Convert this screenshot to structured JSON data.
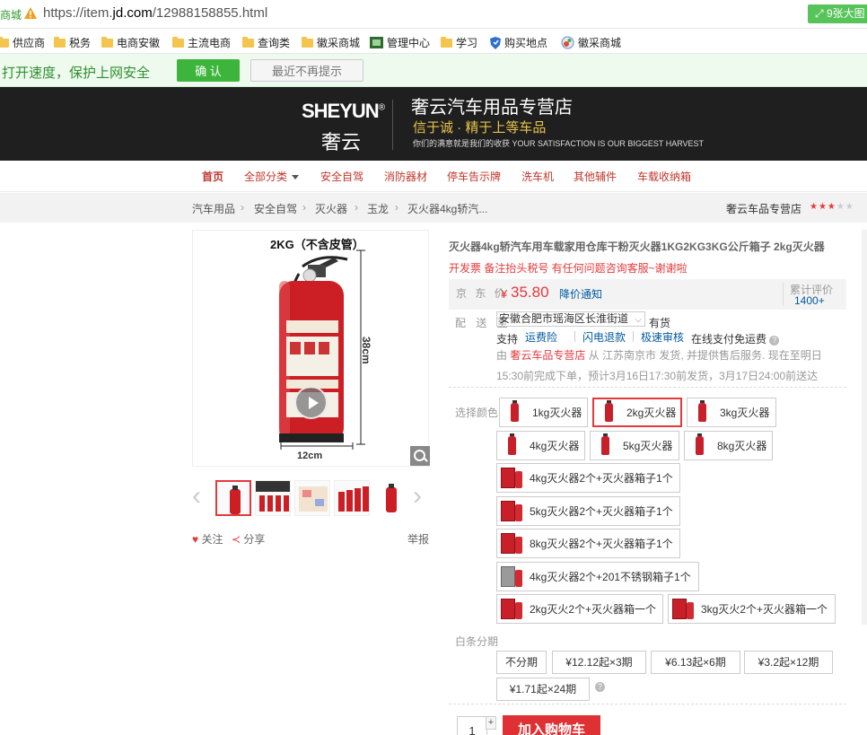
{
  "browser": {
    "url_prefix": "商城",
    "url_scheme": "https://item.",
    "url_domain": "jd.com",
    "url_path": "/12988158855.html",
    "pill_label": "9张大图"
  },
  "bookmarks": [
    {
      "label": "供应商",
      "icon": "folder-icon"
    },
    {
      "label": "税务",
      "icon": "folder-icon"
    },
    {
      "label": "电商安徽",
      "icon": "folder-icon"
    },
    {
      "label": "主流电商",
      "icon": "folder-icon"
    },
    {
      "label": "查询类",
      "icon": "folder-icon"
    },
    {
      "label": "徽采商城",
      "icon": "folder-icon"
    },
    {
      "label": "管理中心",
      "icon": "admin-icon"
    },
    {
      "label": "学习",
      "icon": "folder-icon"
    },
    {
      "label": "购买地点",
      "icon": "shield-icon"
    },
    {
      "label": "徽采商城",
      "icon": "globe-icon"
    }
  ],
  "notice": {
    "message": "打开速度，保护上网安全",
    "confirm_label": "确 认",
    "never_label": "最近不再提示"
  },
  "banner": {
    "logo_en": "SHEYUN",
    "logo_reg": "®",
    "logo_cn": "奢云",
    "shop_name": "奢云汽车用品专营店",
    "slogan": "信于诚 · 精于上等车品",
    "tagline": "你们的满意就是我们的收获 YOUR SATISFACTION IS OUR BIGGEST HARVEST"
  },
  "shop_nav": [
    "首页",
    "全部分类",
    "安全自驾",
    "消防器材",
    "停车告示牌",
    "洗车机",
    "其他辅件",
    "车载收纳箱"
  ],
  "breadcrumb": [
    "汽车用品",
    "安全自驾",
    "灭火器",
    "玉龙",
    "灭火器4kg轿汽..."
  ],
  "shop_link": "奢云车品专营店",
  "shop_rating": {
    "filled": 3,
    "total": 5
  },
  "gallery": {
    "caption": "2KG（不含皮管）",
    "height_label": "38cm",
    "width_label": "12cm",
    "follow_label": "关注",
    "share_label": "分享",
    "report_label": "举报"
  },
  "product": {
    "title": "灭火器4kg轿汽车用车载家用仓库干粉灭火器1KG2KG3KG公斤箱子 2kg灭火器",
    "promo": "开发票 备注抬头税号 有任何问题咨询客服~谢谢啦",
    "price_label": "京 东 价",
    "currency": "¥",
    "price": "35.80",
    "price_notify": "降价通知",
    "reviews_label": "累计评价",
    "reviews_count": "1400+",
    "ship_label": "配 送 至",
    "ship_address": "安徽合肥市瑶海区长淮街道",
    "stock": "有货",
    "support_label": "支持",
    "services": [
      "运费险",
      "闪电退款",
      "极速审核"
    ],
    "free_ship": "在线支付免运费",
    "from_prefix": "由 ",
    "from_shop": "奢云车品专营店",
    "from_suffix": " 从 江苏南京市 发货, 并提供售后服务. 现在至明日",
    "delivery": "15:30前完成下单，预计3月16日17:30前发货，3月17日24:00前送达"
  },
  "options": {
    "label": "选择颜色",
    "items": [
      {
        "label": "1kg灭火器",
        "thumb": "extinguisher-thumb",
        "selected": false
      },
      {
        "label": "2kg灭火器",
        "thumb": "extinguisher-thumb",
        "selected": true
      },
      {
        "label": "3kg灭火器",
        "thumb": "extinguisher-thumb",
        "selected": false
      },
      {
        "label": "4kg灭火器",
        "thumb": "extinguisher-thumb",
        "selected": false
      },
      {
        "label": "5kg灭火器",
        "thumb": "extinguisher-thumb",
        "selected": false
      },
      {
        "label": "8kg灭火器",
        "thumb": "extinguisher-thumb",
        "selected": false
      },
      {
        "label": "4kg灭火器2个+灭火器箱子1个",
        "thumb": "box-thumb",
        "selected": false
      },
      {
        "label": "5kg灭火器2个+灭火器箱子1个",
        "thumb": "box-thumb",
        "selected": false
      },
      {
        "label": "8kg灭火器2个+灭火器箱子1个",
        "thumb": "box-thumb",
        "selected": false
      },
      {
        "label": "4kg灭火器2个+201不锈钢箱子1个",
        "thumb": "steel-box-thumb",
        "selected": false
      },
      {
        "label": "2kg灭火2个+灭火器箱一个",
        "thumb": "box-thumb",
        "selected": false
      },
      {
        "label": "3kg灭火2个+灭火器箱一个",
        "thumb": "box-thumb",
        "selected": false
      }
    ]
  },
  "baitiao": {
    "label": "白条分期",
    "plans": [
      "不分期",
      "¥12.12起×3期",
      "¥6.13起×6期",
      "¥3.2起×12期",
      "¥1.71起×24期"
    ]
  },
  "purchase": {
    "quantity": "1",
    "plus": "+",
    "add_to_cart": "加入购物车"
  },
  "colors": {
    "jd_red": "#e4393c",
    "link_blue": "#005aa0",
    "notice_green": "#3db53d",
    "banner_gold": "#e7c34a"
  }
}
